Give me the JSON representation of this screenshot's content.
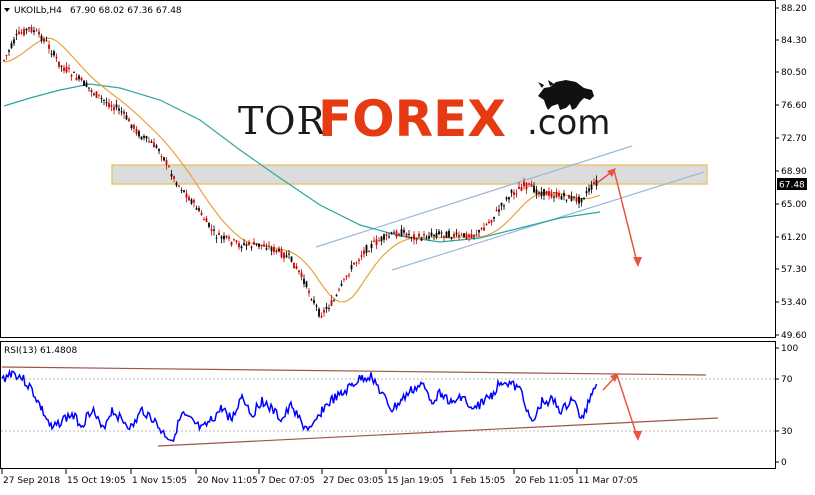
{
  "header": {
    "symbol": "UKOILb,H4",
    "ohlc": "67.90 68.02 67.36 67.48"
  },
  "logo": {
    "tor": "TOR",
    "forex": "FOREX",
    "domain": ".com",
    "icon": "bull-icon"
  },
  "price_axis": {
    "ticks": [
      "88.20",
      "84.30",
      "80.50",
      "76.60",
      "72.70",
      "68.90",
      "65.00",
      "61.20",
      "57.30",
      "53.40",
      "49.60"
    ],
    "current_price": "67.48"
  },
  "rsi": {
    "label": "RSI(13) 61.4808",
    "levels": [
      "100",
      "70",
      "30",
      "0"
    ]
  },
  "time_axis": {
    "labels": [
      "27 Sep 2018",
      "15 Oct 19:05",
      "1 Nov 15:05",
      "20 Nov 11:05",
      "7 Dec 07:05",
      "27 Dec 03:05",
      "15 Jan 19:05",
      "1 Feb 15:05",
      "20 Feb 11:05",
      "11 Mar 07:05"
    ]
  },
  "colors": {
    "bull_candle": "#000000",
    "bear_candle": "#cc0000",
    "ma_fast": "#e8a33a",
    "ma_slow": "#2aa7a0",
    "rsi_line": "#0000ff",
    "rsi_trend": "#a0524a",
    "channel": "#9bb8dc",
    "resistance_zone": "#d9d9d9",
    "arrow": "#e8563f"
  },
  "chart_data": {
    "type": "candlestick",
    "title": "UKOILb,H4",
    "ylim": [
      49.6,
      88.2
    ],
    "rsi_ylim": [
      0,
      100
    ]
  }
}
